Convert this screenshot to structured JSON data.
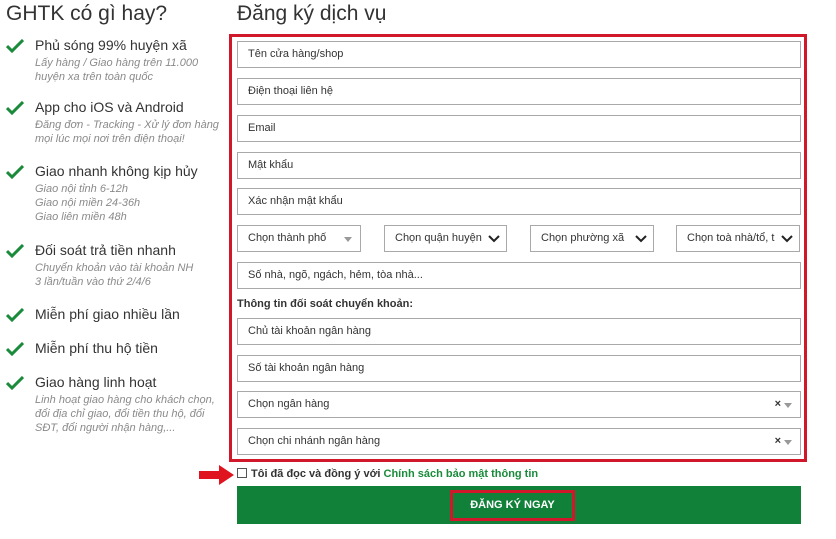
{
  "left": {
    "title": "GHTK có gì hay?",
    "features": [
      {
        "title": "Phủ sóng 99% huyện xã",
        "desc": "Lấy hàng / Giao hàng trên 11.000 huyện xa trên toàn quốc"
      },
      {
        "title": "App cho iOS và Android",
        "desc": "Đăng đơn - Tracking - Xử lý đơn hàng mọi lúc mọi nơi trên điện thoại!"
      },
      {
        "title": "Giao nhanh không kịp hủy",
        "desc_lines": [
          "Giao nội tỉnh 6-12h",
          "Giao nội miền 24-36h",
          "Giao liên miền 48h"
        ]
      },
      {
        "title": "Đối soát trả tiền nhanh",
        "desc_lines": [
          "Chuyển khoản vào tài khoản NH",
          "3 lần/tuần vào thứ 2/4/6"
        ]
      },
      {
        "title": "Miễn phí giao nhiều lần"
      },
      {
        "title": "Miễn phí thu hộ tiền"
      },
      {
        "title": "Giao hàng linh hoạt",
        "desc": "Linh hoạt giao hàng cho khách chọn, đổi địa chỉ giao, đổi tiền thu hộ, đổi SĐT, đổi người nhận hàng,..."
      }
    ]
  },
  "form": {
    "title": "Đăng ký dịch vụ",
    "fields": {
      "shop_name": "Tên cửa hàng/shop",
      "phone": "Điện thoại liên hệ",
      "email": "Email",
      "password": "Mật khẩu",
      "confirm_password": "Xác nhận mật khẩu",
      "address": "Số nhà, ngõ, ngách, hẻm, tòa nhà..."
    },
    "selects": {
      "city": "Chọn thành phố",
      "district": "Chọn quận huyện",
      "ward": "Chọn phường xã",
      "building": "Chọn toà nhà/tổ, t"
    },
    "bank_section_label": "Thông tin đối soát chuyển khoản:",
    "bank": {
      "holder": "Chủ tài khoản ngân hàng",
      "account_number": "Số tài khoản ngân hàng",
      "bank_select": "Chọn ngân hàng",
      "branch_select": "Chọn chi nhánh ngân hàng",
      "clear_symbol": "×"
    },
    "agree_text": "Tôi đã đọc và đồng ý với ",
    "agree_link": "Chính sách bảo mật thông tin",
    "submit_label": "ĐĂNG KÝ NGAY"
  },
  "colors": {
    "accent_green": "#11813a",
    "check_green": "#1a8b3a",
    "highlight_red": "#d0182a"
  }
}
